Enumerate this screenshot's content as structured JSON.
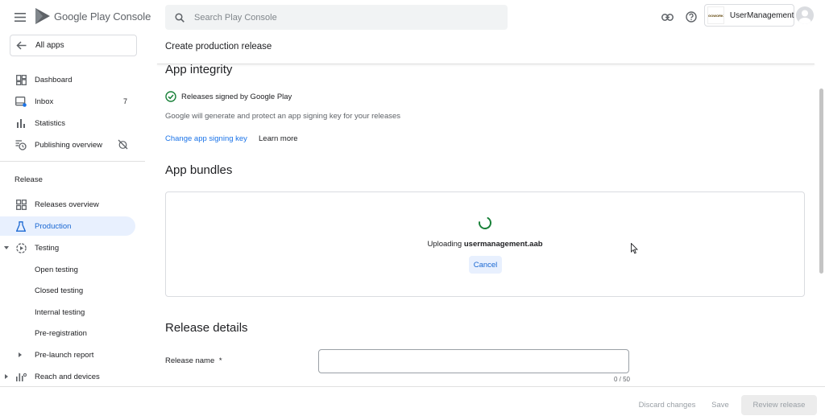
{
  "topbar": {
    "brand": "Google Play Console",
    "search_placeholder": "Search Play Console",
    "account_name": "UserManagement",
    "account_logo_text": "GOWORK"
  },
  "sidebar": {
    "all_apps": "All apps",
    "items": {
      "dashboard": "Dashboard",
      "inbox": "Inbox",
      "inbox_count": "7",
      "statistics": "Statistics",
      "publishing_overview": "Publishing overview"
    },
    "release_section": "Release",
    "release_items": {
      "releases_overview": "Releases overview",
      "production": "Production",
      "testing": "Testing",
      "open_testing": "Open testing",
      "closed_testing": "Closed testing",
      "internal_testing": "Internal testing",
      "pre_registration": "Pre-registration",
      "pre_launch_report": "Pre-launch report",
      "reach_and_devices": "Reach and devices"
    }
  },
  "main": {
    "page_title": "Create production release",
    "app_integrity": {
      "title": "App integrity",
      "status": "Releases signed by Google Play",
      "description": "Google will generate and protect an app signing key for your releases",
      "change_key_link": "Change app signing key",
      "learn_more_link": "Learn more"
    },
    "app_bundles": {
      "title": "App bundles",
      "uploading_prefix": "Uploading",
      "filename": "usermanagement.aab",
      "cancel": "Cancel"
    },
    "release_details": {
      "title": "Release details",
      "release_name_label": "Release name",
      "required_mark": "*",
      "release_name_value": "",
      "counter": "0 / 50"
    }
  },
  "footer": {
    "discard": "Discard changes",
    "save": "Save",
    "review": "Review release"
  },
  "colors": {
    "accent": "#1a73e8",
    "active_bg": "#e8f0fe",
    "success": "#188038"
  }
}
